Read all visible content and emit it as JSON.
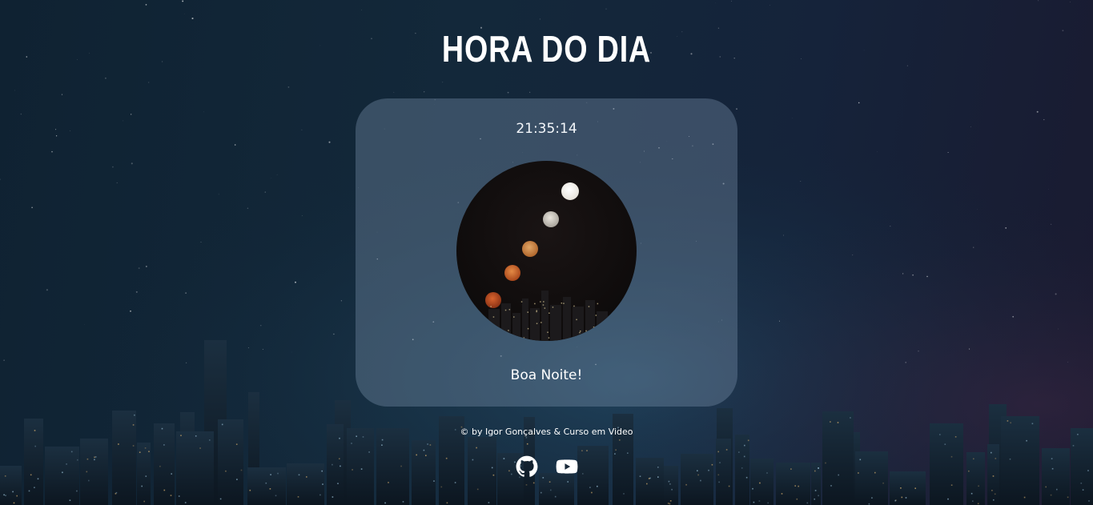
{
  "header": {
    "title": "HORA DO DIA"
  },
  "clock": {
    "time": "21:35:14"
  },
  "image": {
    "description_icon": "night-moon-photo"
  },
  "greeting": {
    "text": "Boa Noite!"
  },
  "footer": {
    "credit": "© by Igor Gonçalves & Curso em Video",
    "links": [
      {
        "icon": "github-icon"
      },
      {
        "icon": "youtube-icon"
      }
    ]
  },
  "colors": {
    "background": "#13283a",
    "card": "#5d7286",
    "text": "#ffffff"
  }
}
